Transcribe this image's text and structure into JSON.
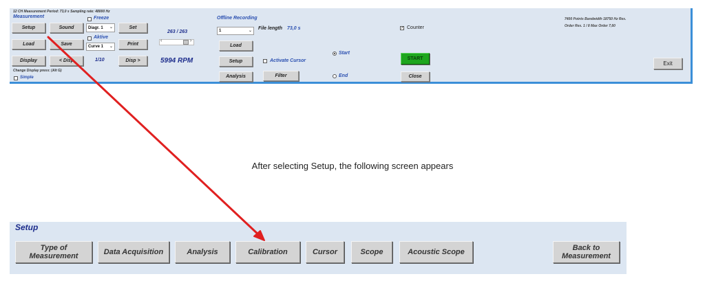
{
  "top": {
    "status_line": "12 CH Measurement Period: 73,0 s Sampling rate: 48000 Hz",
    "measurement_label": "Measurement",
    "freeze_label": "Freeze",
    "aktive_label": "Aktive",
    "setup_btn": "Setup",
    "sound_btn": "Sound",
    "load_btn": "Load",
    "save_btn": "Save",
    "display_btn": "Display",
    "disp_prev_btn": "< Disp",
    "disp_next_btn": "Disp >",
    "set_btn": "Set",
    "print_btn": "Print",
    "diagr_select": "Diagr. 1",
    "curve_select": "Curve 1",
    "page_counter": "1/10",
    "frame_counter": "263 / 263",
    "rpm_value": "5994 RPM",
    "change_display_hint": "Change Display press: (Alt G)",
    "simple_label": "Simple",
    "offline_title": "Offline Recording",
    "offline_select": "1",
    "file_length_label": "File length",
    "file_length_value": "73,0 s",
    "offline_load_btn": "Load",
    "offline_setup_btn": "Setup",
    "analysis_btn": "Analysis",
    "activate_cursor_label": "Activate Cursor",
    "filter_btn": "Filter",
    "start_radio_label": "Start",
    "end_radio_label": "End",
    "counter_label": "Counter",
    "start_btn": "START",
    "close_btn": "Close",
    "info_line1": "7400 Points  Bandwidth 18750 Hz  Res.",
    "info_line2": "Order Res.  1 / 8  Max Order 7,60",
    "exit_btn": "Exit"
  },
  "caption": "After selecting Setup, the following screen appears",
  "setup": {
    "title": "Setup",
    "buttons": {
      "type_of_measurement": "Type of Measurement",
      "data_acquisition": "Data Acquisition",
      "analysis": "Analysis",
      "calibration": "Calibration",
      "cursor": "Cursor",
      "scope": "Scope",
      "acoustic_scope": "Acoustic Scope",
      "back_line1": "Back to",
      "back_line2": "Measurement"
    }
  },
  "colors": {
    "panel_bg": "#dde6f1",
    "accent_blue": "#3b8fd8",
    "arrow_red": "#e02020",
    "start_green": "#1ea61e"
  },
  "icons": {
    "dropdown": "chevron-down-icon",
    "checkbox": "checkbox-icon",
    "radio": "radio-icon",
    "annotation": "red-arrow-icon"
  }
}
